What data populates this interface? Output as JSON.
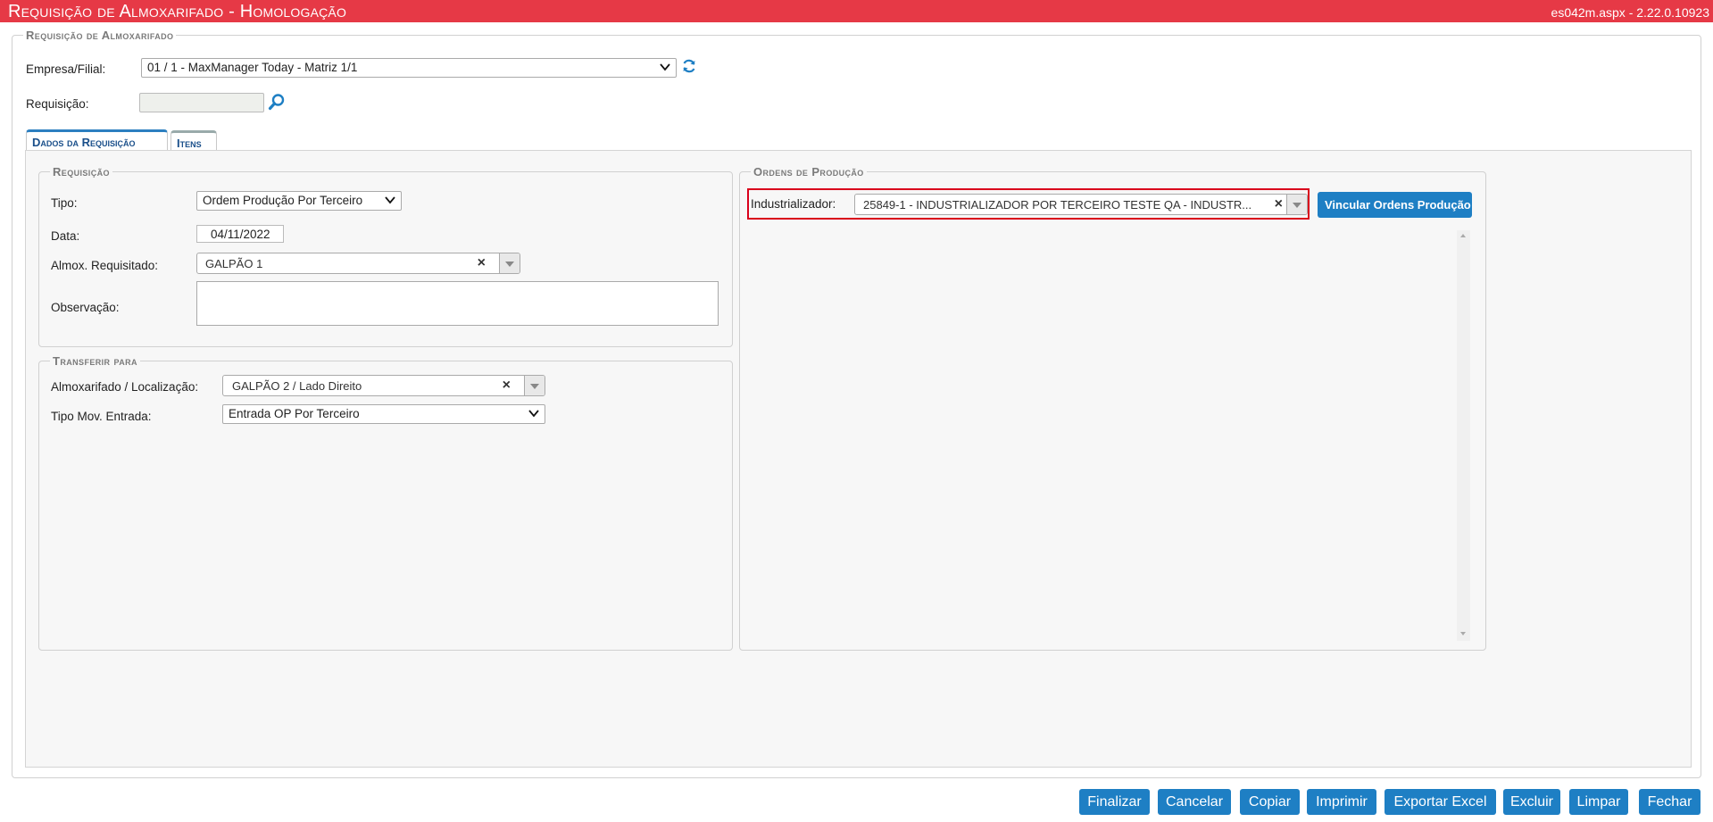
{
  "window": {
    "title": "Requisição de Almoxarifado  - Homologação",
    "version": "es042m.aspx - 2.22.0.10923"
  },
  "header_section": {
    "legend": "Requisição de Almoxarifado",
    "empresa_label": "Empresa/Filial:",
    "empresa_value": "01 / 1 - MaxManager Today - Matriz 1/1",
    "requisicao_label": "Requisição:",
    "requisicao_value": ""
  },
  "tabs": [
    {
      "label": "Dados da Requisição",
      "active": true
    },
    {
      "label": "Itens",
      "active": false
    }
  ],
  "requisicao": {
    "legend": "Requisição",
    "tipo_label": "Tipo:",
    "tipo_value": "Ordem Produção Por Terceiro",
    "data_label": "Data:",
    "data_value": "04/11/2022",
    "almox_label": "Almox. Requisitado:",
    "almox_value": "GALPÃO 1",
    "obs_label": "Observação:",
    "obs_value": ""
  },
  "transferir": {
    "legend": "Transferir para",
    "almox_label": "Almoxarifado / Localização:",
    "almox_value": "GALPÃO 2 / Lado Direito",
    "tipo_mov_label": "Tipo Mov. Entrada:",
    "tipo_mov_value": "Entrada OP Por Terceiro"
  },
  "ordens": {
    "legend": "Ordens de Produção",
    "industrializador_label": "Industrializador:",
    "industrializador_value": "25849-1 - INDUSTRIALIZADOR POR TERCEIRO TESTE QA - INDUSTR...",
    "vincular_label": "Vincular Ordens Produção"
  },
  "footer_buttons": {
    "finalizar": "Finalizar",
    "cancelar": "Cancelar",
    "copiar": "Copiar",
    "imprimir": "Imprimir",
    "exportar": "Exportar Excel",
    "excluir": "Excluir",
    "limpar": "Limpar",
    "fechar": "Fechar"
  },
  "colors": {
    "titlebar": "#e63946",
    "button": "#1e7fc4",
    "highlight": "#d9001b"
  }
}
